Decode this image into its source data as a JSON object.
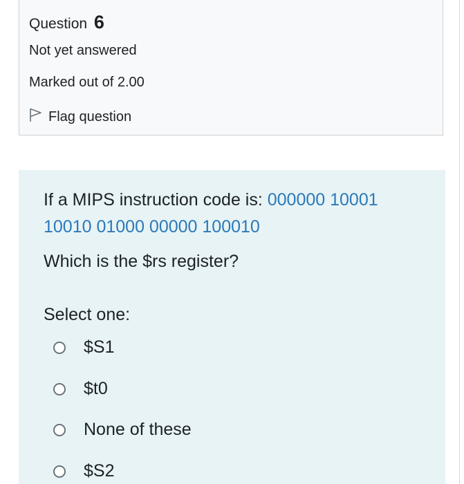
{
  "info": {
    "question_label": "Question",
    "question_number": "6",
    "state": "Not yet answered",
    "grade": "Marked out of 2.00",
    "flag_label": "Flag question"
  },
  "question": {
    "text_prefix": "If a MIPS instruction code is: ",
    "code_line1": "000000 10001",
    "code_line2": "10010 01000 00000 100010",
    "prompt": "Which is the $rs register?",
    "select_one": "Select one:",
    "options": [
      {
        "label": "$S1"
      },
      {
        "label": "$t0"
      },
      {
        "label": "None of these"
      },
      {
        "label": "$S2"
      }
    ]
  },
  "colors": {
    "info_background": "#f8f9fa",
    "content_background": "#e7f3f5",
    "code_text": "#2b79b9"
  }
}
